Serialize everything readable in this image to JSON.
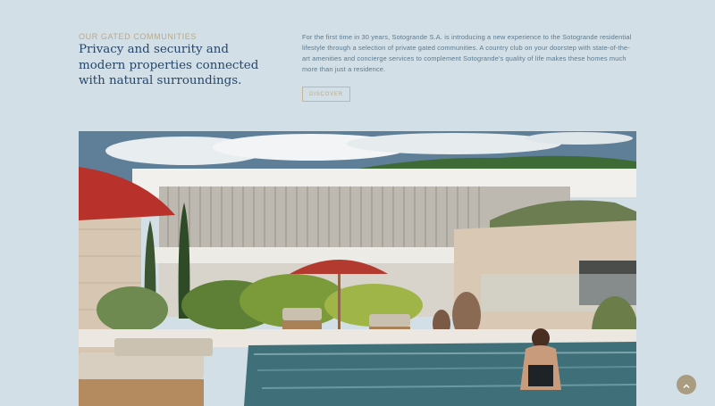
{
  "intro": {
    "eyebrow": "OUR GATED COMMUNITIES",
    "headline": "Privacy and security and modern properties connected with natural surroundings.",
    "body": "For the first time in 30 years, Sotogrande S.A. is introducing a new experience to the Sotogrande residential lifestyle through a selection of private gated communities. A country club on your doorstep with state-of-the-art amenities and concierge services to complement Sotogrande's quality of life makes these homes much more than just a residence.",
    "button_label": "DISCOVER"
  },
  "hero": {
    "image": "modern-villa-pool-photo"
  },
  "scroll_top": {
    "icon": "chevron-up-icon"
  },
  "colors": {
    "background": "#d2dfe6",
    "accent_gold": "#b9a98a",
    "headline_navy": "#26466a",
    "body_text": "#5b7a8f",
    "scroll_button": "#a99c80"
  }
}
